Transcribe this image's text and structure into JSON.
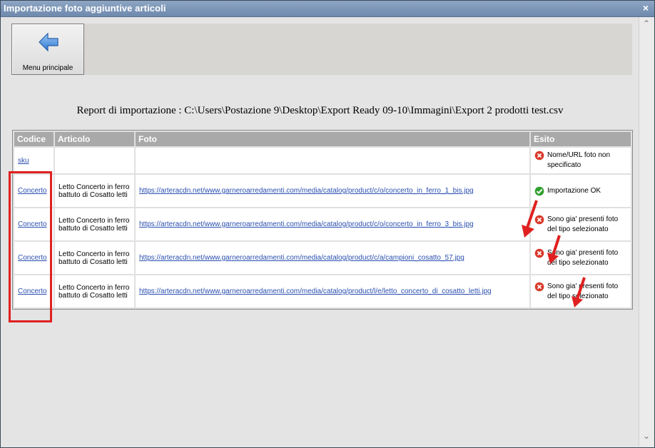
{
  "window": {
    "title": "Importazione foto aggiuntive articoli",
    "close_label": "×"
  },
  "toolbar": {
    "menu_label": "Menu principale",
    "menu_icon": "back-arrow-icon"
  },
  "report": {
    "text": "Report di importazione : C:\\Users\\Postazione 9\\Desktop\\Export Ready 09-10\\Immagini\\Export 2 prodotti test.csv"
  },
  "table": {
    "headers": [
      "Codice",
      "Articolo",
      "Foto",
      "Esito"
    ],
    "rows": [
      {
        "codice": "sku",
        "articolo": "",
        "foto": "",
        "esito": "Nome/URL foto non specificato",
        "status": "error"
      },
      {
        "codice": "Concerto",
        "articolo": "Letto Concerto in ferro battuto di Cosatto letti",
        "foto": "https://arteracdn.net/www.garneroarredamenti.com/media/catalog/product/c/o/concerto_in_ferro_1_bis.jpg",
        "esito": "Importazione OK",
        "status": "ok"
      },
      {
        "codice": "Concerto",
        "articolo": "Letto Concerto in ferro battuto di Cosatto letti",
        "foto": "https://arteracdn.net/www.garneroarredamenti.com/media/catalog/product/c/o/concerto_in_ferro_3_bis.jpg",
        "esito": "Sono gia' presenti foto del tipo selezionato",
        "status": "error"
      },
      {
        "codice": "Concerto",
        "articolo": "Letto Concerto in ferro battuto di Cosatto letti",
        "foto": "https://arteracdn.net/www.garneroarredamenti.com/media/catalog/product/c/a/campioni_cosatto_57.jpg",
        "esito": "Sono gia' presenti foto del tipo selezionato",
        "status": "error"
      },
      {
        "codice": "Concerto",
        "articolo": "Letto Concerto in ferro battuto di Cosatto letti",
        "foto": "https://arteracdn.net/www.garneroarredamenti.com/media/catalog/product/l/e/letto_concerto_di_cosatto_letti.jpg",
        "esito": "Sono gia' presenti foto del tipo selezionato",
        "status": "error"
      }
    ]
  },
  "colors": {
    "titlebar": "#7f98bb",
    "header_bg": "#a9a9a9",
    "link": "#2a4fb0",
    "annotation": "#e02020",
    "ok": "#2fa02f",
    "error": "#d83a2a"
  }
}
